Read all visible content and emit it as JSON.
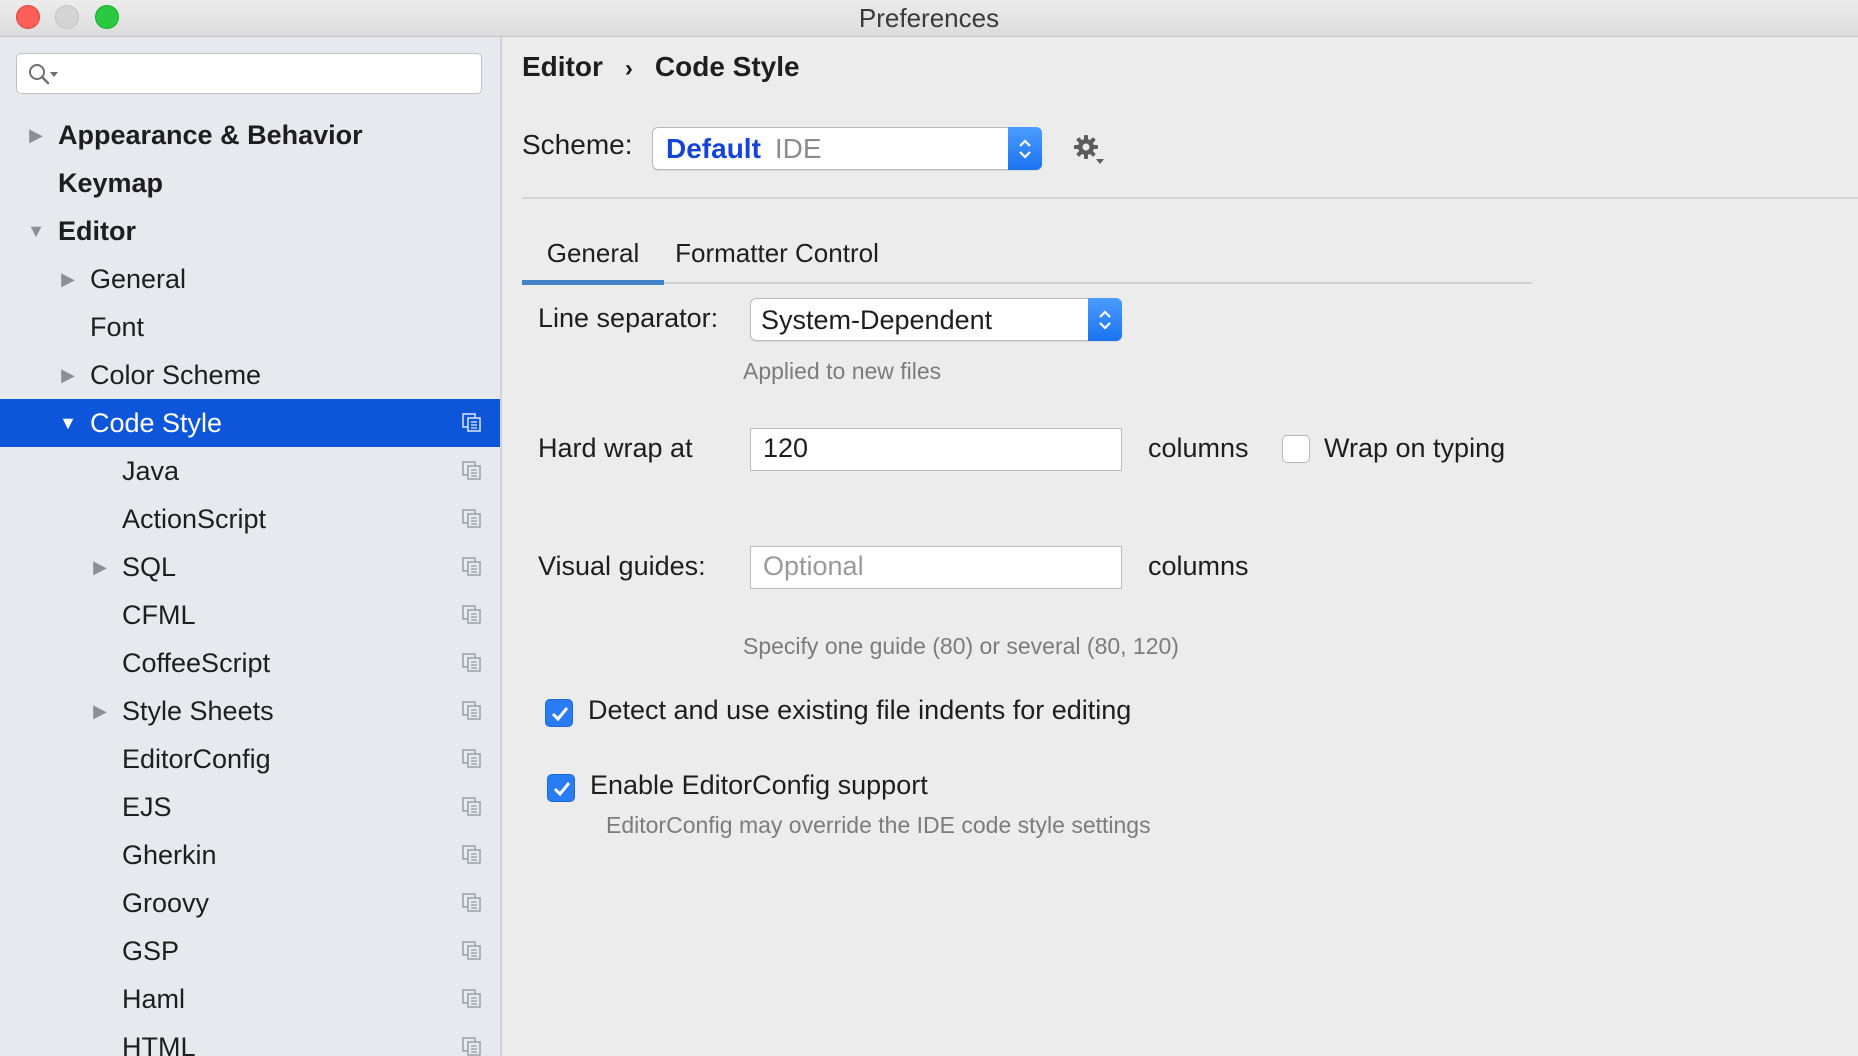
{
  "window": {
    "title": "Preferences"
  },
  "search": {
    "value": ""
  },
  "sidebar": {
    "items": [
      {
        "label": "Appearance & Behavior",
        "bold": true,
        "level": 0,
        "arrow": "collapsed"
      },
      {
        "label": "Keymap",
        "bold": true,
        "level": 0,
        "arrow": "none"
      },
      {
        "label": "Editor",
        "bold": true,
        "level": 0,
        "arrow": "expanded"
      },
      {
        "label": "General",
        "level": 1,
        "arrow": "collapsed"
      },
      {
        "label": "Font",
        "level": 1,
        "arrow": "none"
      },
      {
        "label": "Color Scheme",
        "level": 1,
        "arrow": "collapsed"
      },
      {
        "label": "Code Style",
        "level": 1,
        "arrow": "expanded",
        "selected": true,
        "copy_icon": true
      },
      {
        "label": "Java",
        "level": 2,
        "arrow": "none",
        "copy_icon": true
      },
      {
        "label": "ActionScript",
        "level": 2,
        "arrow": "none",
        "copy_icon": true
      },
      {
        "label": "SQL",
        "level": 2,
        "arrow": "collapsed",
        "copy_icon": true
      },
      {
        "label": "CFML",
        "level": 2,
        "arrow": "none",
        "copy_icon": true
      },
      {
        "label": "CoffeeScript",
        "level": 2,
        "arrow": "none",
        "copy_icon": true
      },
      {
        "label": "Style Sheets",
        "level": 2,
        "arrow": "collapsed",
        "copy_icon": true
      },
      {
        "label": "EditorConfig",
        "level": 2,
        "arrow": "none",
        "copy_icon": true
      },
      {
        "label": "EJS",
        "level": 2,
        "arrow": "none",
        "copy_icon": true
      },
      {
        "label": "Gherkin",
        "level": 2,
        "arrow": "none",
        "copy_icon": true
      },
      {
        "label": "Groovy",
        "level": 2,
        "arrow": "none",
        "copy_icon": true
      },
      {
        "label": "GSP",
        "level": 2,
        "arrow": "none",
        "copy_icon": true
      },
      {
        "label": "Haml",
        "level": 2,
        "arrow": "none",
        "copy_icon": true
      },
      {
        "label": "HTML",
        "level": 2,
        "arrow": "none",
        "copy_icon": true
      }
    ]
  },
  "breadcrumb": {
    "parent": "Editor",
    "separator": "›",
    "current": "Code Style"
  },
  "scheme": {
    "label": "Scheme:",
    "value": "Default",
    "qualifier": "IDE"
  },
  "tabs": [
    {
      "label": "General",
      "active": true
    },
    {
      "label": "Formatter Control",
      "active": false
    }
  ],
  "general": {
    "line_separator_label": "Line separator:",
    "line_separator_value": "System-Dependent",
    "line_separator_hint": "Applied to new files",
    "hard_wrap_label": "Hard wrap at",
    "hard_wrap_value": "120",
    "hard_wrap_unit": "columns",
    "wrap_on_typing_label": "Wrap on typing",
    "wrap_on_typing_checked": false,
    "visual_guides_label": "Visual guides:",
    "visual_guides_value": "",
    "visual_guides_placeholder": "Optional",
    "visual_guides_unit": "columns",
    "visual_guides_hint": "Specify one guide (80) or several (80, 120)",
    "detect_indents_label": "Detect and use existing file indents for editing",
    "detect_indents_checked": true,
    "editorconfig_label": "Enable EditorConfig support",
    "editorconfig_checked": true,
    "editorconfig_hint": "EditorConfig may override the IDE code style settings"
  },
  "colors": {
    "selection": "#0e56d9",
    "accent": "#2a7cf4",
    "scheme_value": "#1445d8"
  }
}
